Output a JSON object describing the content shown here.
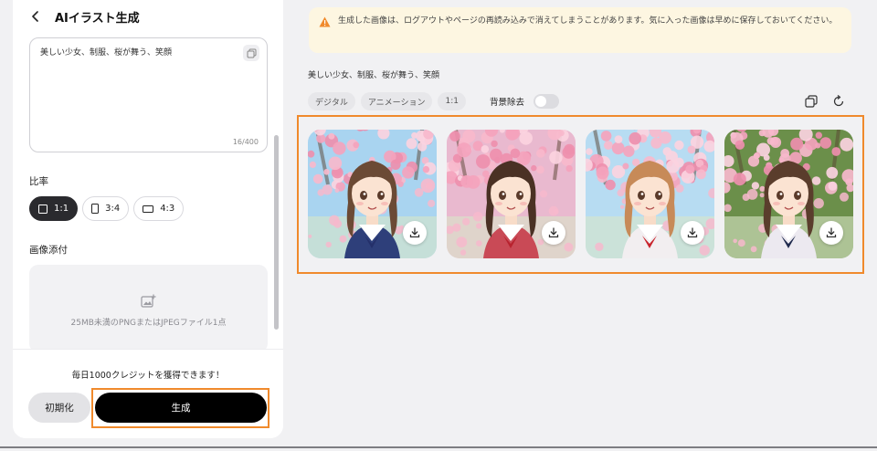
{
  "header": {
    "title": "AIイラスト生成"
  },
  "prompt": {
    "text": "美しい少女、制服、桜が舞う、笑顔",
    "char_count": "16/400"
  },
  "ratio": {
    "label": "比率",
    "options": [
      {
        "label": "1:1",
        "active": true
      },
      {
        "label": "3:4",
        "active": false
      },
      {
        "label": "4:3",
        "active": false
      }
    ]
  },
  "attachment": {
    "label": "画像添付",
    "hint": "25MB未満のPNGまたはJPEGファイル1点"
  },
  "footer": {
    "credit_text": "毎日1000クレジットを獲得できます！",
    "reset_label": "初期化",
    "generate_label": "生成"
  },
  "notice": {
    "text": "生成した画像は、ログアウトやページの再読み込みで消えてしまうことがあります。気に入った画像は早めに保存しておいてください。"
  },
  "result": {
    "prompt_text": "美しい少女、制服、桜が舞う、笑顔",
    "tags": [
      "デジタル",
      "アニメーション",
      "1:1"
    ],
    "bg_remove_label": "背景除去",
    "bg_remove_on": false
  },
  "images": [
    {
      "hair": "#6b4a35",
      "sky": "#a9d4f0",
      "uniform": "#2e3f7a",
      "ribbon": "#24306a"
    },
    {
      "hair": "#4a3124",
      "sky": "#e9b9cf",
      "uniform": "#c94a56",
      "ribbon": "#b8222e"
    },
    {
      "hair": "#c78a58",
      "sky": "#b7dcf2",
      "uniform": "#f2eef0",
      "ribbon": "#c8232c"
    },
    {
      "hair": "#5a3d2c",
      "sky": "#6b8f4a",
      "uniform": "#ece9f0",
      "ribbon": "#1f2a4d"
    }
  ],
  "colors": {
    "accent": "#f08a2c",
    "primary_button": "#000000",
    "notice_bg": "#fdf6e1"
  }
}
